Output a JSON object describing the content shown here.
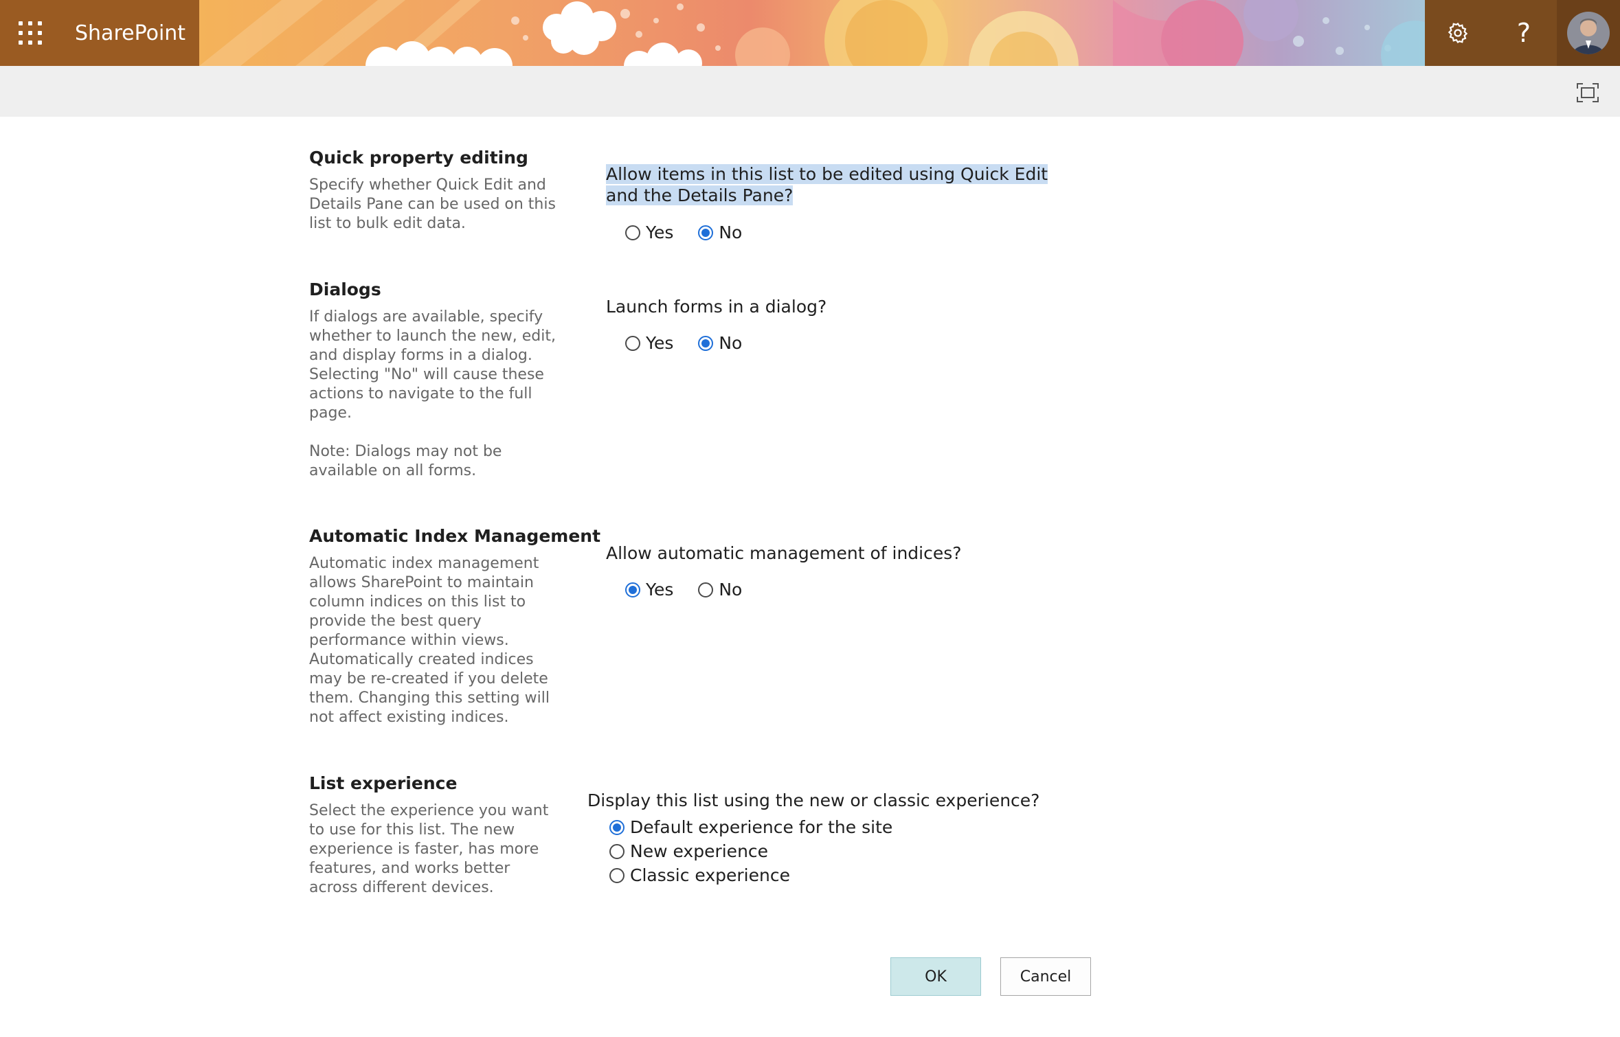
{
  "header": {
    "app_name": "SharePoint",
    "help_glyph": "?",
    "icons": {
      "waffle": "app-launcher-icon",
      "settings": "gear-icon",
      "help": "question-mark-icon",
      "avatar": "user-avatar",
      "focus": "focus-mode-icon"
    },
    "colors": {
      "brand_bg": "#9a5b22",
      "accent": "#1f6fd8",
      "selection": "#c8dcf2"
    }
  },
  "sections": {
    "quick_edit": {
      "title": "Quick property editing",
      "description": "Specify whether Quick Edit and Details Pane can be used on this list to bulk edit data.",
      "question": "Allow items in this list to be edited using Quick Edit and the Details Pane?",
      "options": [
        "Yes",
        "No"
      ],
      "selected": "No"
    },
    "dialogs": {
      "title": "Dialogs",
      "description": "If dialogs are available, specify whether to launch the new, edit, and display forms in a dialog. Selecting \"No\" will cause these actions to navigate to the full page.",
      "note": "Note: Dialogs may not be available on all forms.",
      "question": "Launch forms in a dialog?",
      "options": [
        "Yes",
        "No"
      ],
      "selected": "No"
    },
    "index_mgmt": {
      "title": "Automatic Index Management",
      "description": "Automatic index management allows SharePoint to maintain column indices on this list to provide the best query performance within views. Automatically created indices may be re-created if you delete them. Changing this setting will not affect existing indices.",
      "question": "Allow automatic management of indices?",
      "options": [
        "Yes",
        "No"
      ],
      "selected": "Yes"
    },
    "list_experience": {
      "title": "List experience",
      "description": "Select the experience you want to use for this list. The new experience is faster, has more features, and works better across different devices.",
      "question": "Display this list using the new or classic experience?",
      "options": [
        "Default experience for the site",
        "New experience",
        "Classic experience"
      ],
      "selected": "Default experience for the site"
    }
  },
  "footer": {
    "ok_label": "OK",
    "cancel_label": "Cancel"
  }
}
